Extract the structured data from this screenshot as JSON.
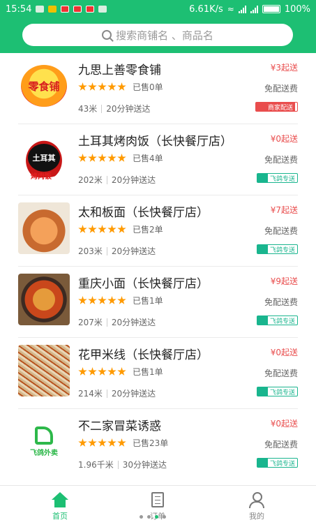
{
  "status_bar": {
    "time": "15:54",
    "network_speed": "6.61K/s",
    "battery": "100%"
  },
  "search": {
    "placeholder": "搜索商铺名 、商品名"
  },
  "shops": [
    {
      "name": "九思上善零食铺",
      "thumb": "零食铺",
      "sold": "已售0单",
      "distance": "43米",
      "delivery_time": "20分钟送达",
      "min_order": "¥3起送",
      "fee": "免配送费",
      "badge_type": "merchant",
      "badge": "商家配送",
      "rating_stars": 5
    },
    {
      "name": "土耳其烤肉饭（长快餐厅店）",
      "thumb": "土耳其",
      "thumb_sub": "烤肉饭",
      "sold": "已售4单",
      "distance": "202米",
      "delivery_time": "20分钟送达",
      "min_order": "¥0起送",
      "fee": "免配送费",
      "badge_type": "platform",
      "badge": "飞鸽专送",
      "rating_stars": 5
    },
    {
      "name": "太和板面（长快餐厅店）",
      "sold": "已售2单",
      "distance": "203米",
      "delivery_time": "20分钟送达",
      "min_order": "¥7起送",
      "fee": "免配送费",
      "badge_type": "platform",
      "badge": "飞鸽专送",
      "rating_stars": 5
    },
    {
      "name": "重庆小面（长快餐厅店）",
      "sold": "已售1单",
      "distance": "207米",
      "delivery_time": "20分钟送达",
      "min_order": "¥9起送",
      "fee": "免配送费",
      "badge_type": "platform",
      "badge": "飞鸽专送",
      "rating_stars": 5
    },
    {
      "name": "花甲米线（长快餐厅店）",
      "sold": "已售1单",
      "distance": "214米",
      "delivery_time": "20分钟送达",
      "min_order": "¥0起送",
      "fee": "免配送费",
      "badge_type": "platform",
      "badge": "飞鸽专送",
      "rating_stars": 5
    },
    {
      "name": "不二家冒菜诱惑",
      "thumb": "飞鸽外卖",
      "sold": "已售23单",
      "distance": "1.96千米",
      "delivery_time": "30分钟送达",
      "min_order": "¥0起送",
      "fee": "免配送费",
      "badge_type": "platform",
      "badge": "飞鸽专送",
      "rating_stars": 5
    }
  ],
  "tabs": [
    {
      "label": "首页",
      "active": true,
      "icon": "home-icon"
    },
    {
      "label": "订单",
      "active": false,
      "icon": "order-icon"
    },
    {
      "label": "我的",
      "active": false,
      "icon": "user-icon"
    }
  ],
  "colors": {
    "brand_green": "#1dbf73",
    "price_red": "#e94d4d",
    "star_orange": "#ff9a00",
    "platform_teal": "#19b58e"
  }
}
